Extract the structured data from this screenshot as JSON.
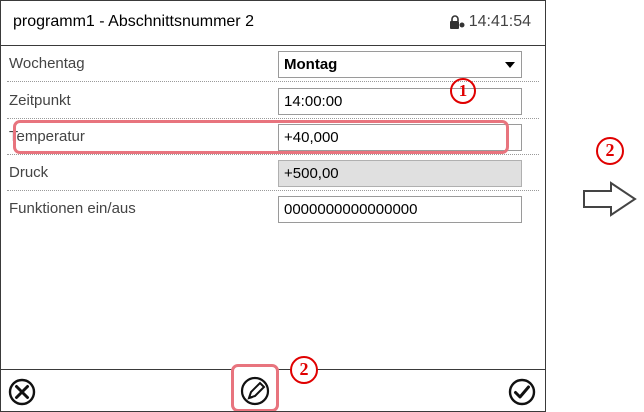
{
  "header": {
    "title": "programm1 - Abschnittsnummer 2",
    "time": "14:41:54"
  },
  "rows": [
    {
      "label": "Wochentag",
      "value": "Montag"
    },
    {
      "label": "Zeitpunkt",
      "value": "14:00:00"
    },
    {
      "label": "Temperatur",
      "value": "+40,000"
    },
    {
      "label": "Druck",
      "value": "+500,00"
    },
    {
      "label": "Funktionen ein/aus",
      "value": "0000000000000000"
    }
  ],
  "callouts": {
    "one": "1",
    "two": "2"
  },
  "icons": {
    "lock": "lock-icon",
    "cancel": "cancel-icon",
    "edit": "pencil-icon",
    "confirm": "checkmark-icon",
    "next": "arrow-right-icon"
  },
  "colors": {
    "highlight": "#e8747e",
    "callout": "#e00000",
    "disabled_field": "#e0e0e0"
  }
}
